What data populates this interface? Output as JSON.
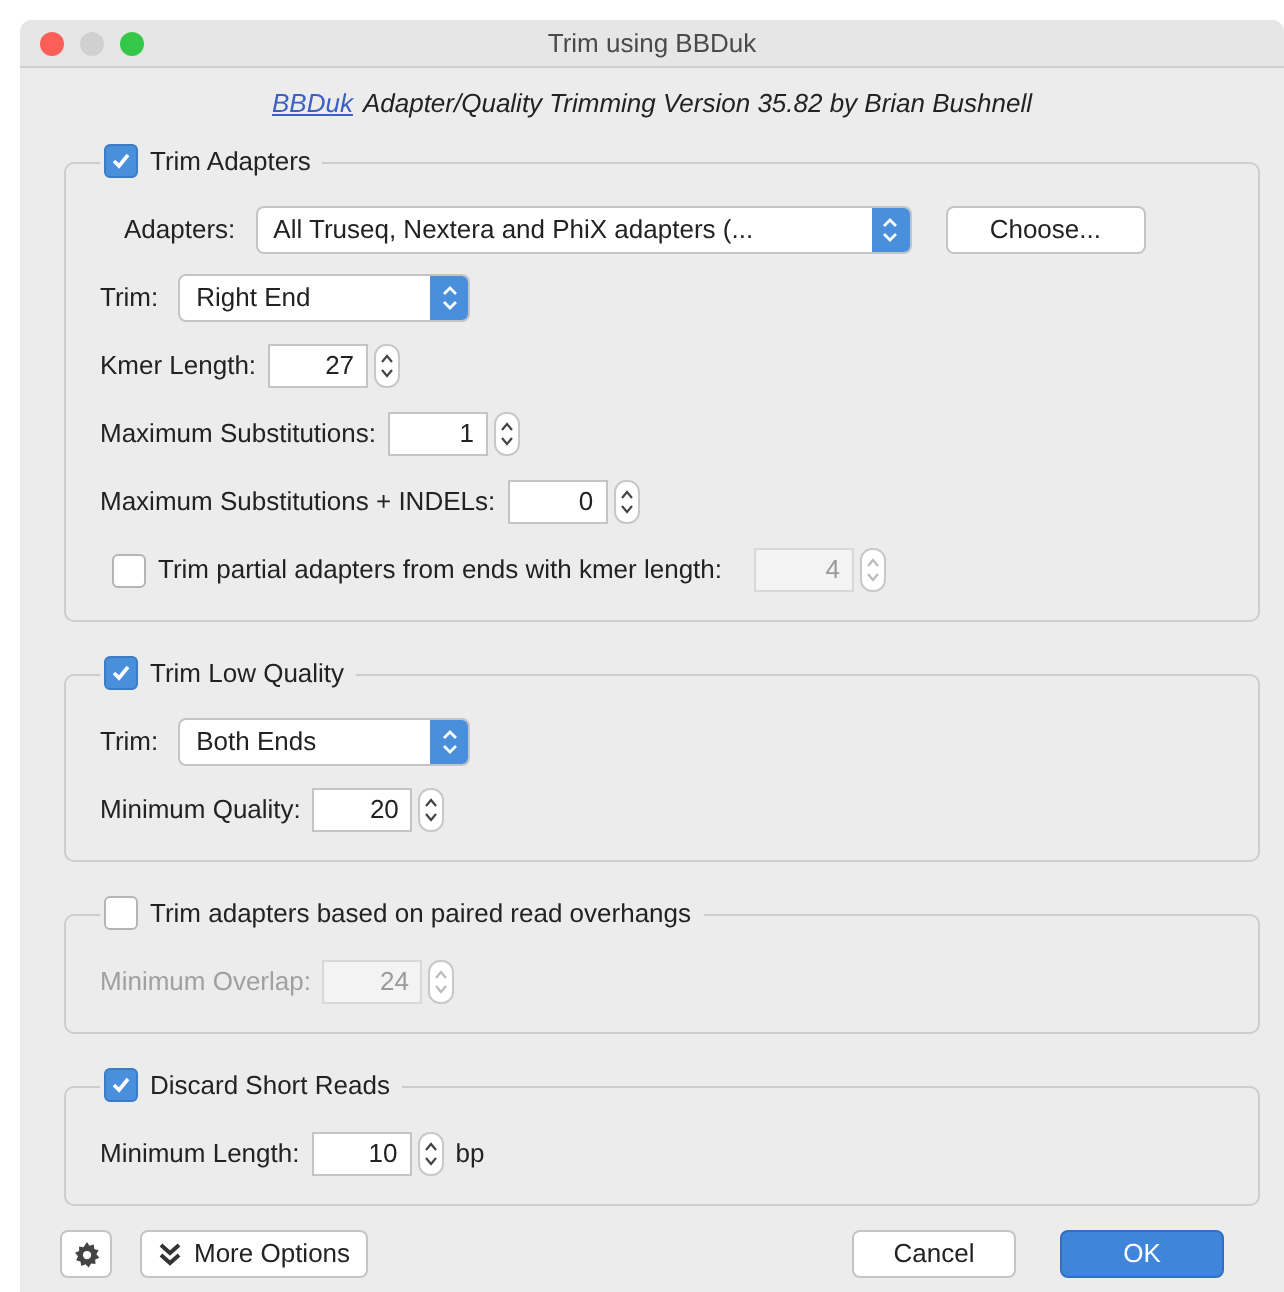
{
  "window": {
    "title": "Trim using BBDuk"
  },
  "header": {
    "link": "BBDuk",
    "text": "Adapter/Quality Trimming Version 35.82 by Brian Bushnell"
  },
  "groups": [
    {
      "label": "Trim Adapters",
      "checked": true,
      "rows": [
        {
          "kind": "adapter_select",
          "label": "Adapters:",
          "value": "All Truseq, Nextera and PhiX adapters (...",
          "button": "Choose..."
        },
        {
          "kind": "select",
          "label": "Trim:",
          "value": "Right End"
        },
        {
          "kind": "spinner",
          "label": "Kmer Length:",
          "value": "27",
          "disabled": false
        },
        {
          "kind": "spinner",
          "label": "Maximum Substitutions:",
          "value": "1",
          "disabled": false
        },
        {
          "kind": "spinner",
          "label": "Maximum Substitutions + INDELs:",
          "value": "0",
          "disabled": false
        },
        {
          "kind": "check_spinner",
          "label": "Trim partial adapters from ends with kmer length:",
          "checked": false,
          "value": "4",
          "disabled": true
        }
      ]
    },
    {
      "label": "Trim Low Quality",
      "checked": true,
      "rows": [
        {
          "kind": "select",
          "label": "Trim:",
          "value": "Both Ends"
        },
        {
          "kind": "spinner",
          "label": "Minimum Quality:",
          "value": "20",
          "disabled": false
        }
      ]
    },
    {
      "label": "Trim adapters based on paired read overhangs",
      "checked": false,
      "rows": [
        {
          "kind": "spinner",
          "label": "Minimum Overlap:",
          "value": "24",
          "disabled": true
        }
      ]
    },
    {
      "label": "Discard Short Reads",
      "checked": true,
      "rows": [
        {
          "kind": "spinner",
          "label": "Minimum Length:",
          "value": "10",
          "disabled": false,
          "unit": "bp"
        }
      ]
    }
  ],
  "footer": {
    "more": "More Options",
    "buttons": [
      {
        "label": "Cancel",
        "primary": false
      },
      {
        "label": "OK",
        "primary": true
      }
    ]
  }
}
